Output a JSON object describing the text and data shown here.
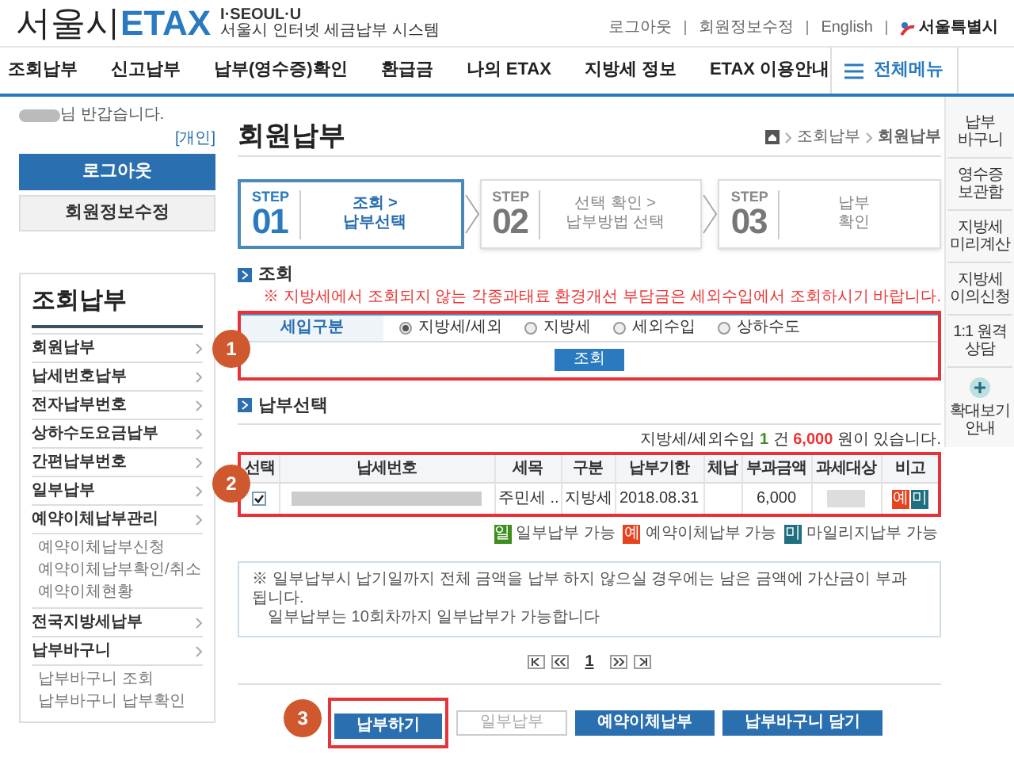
{
  "header": {
    "logo_main": "서울시",
    "logo_accent": "ETAX",
    "brand": "I·SEOUL·U",
    "subtitle": "서울시 인터넷 세금납부 시스템",
    "top_links": [
      "로그아웃",
      "회원정보수정",
      "English"
    ],
    "city": "서울특별시"
  },
  "nav": {
    "items": [
      "조회납부",
      "신고납부",
      "납부(영수증)확인",
      "환급금",
      "나의 ETAX",
      "지방세 정보",
      "ETAX 이용안내"
    ],
    "all_menu": "전체메뉴"
  },
  "member": {
    "greeting": "님 반갑습니다.",
    "type": "[개인]",
    "logout": "로그아웃",
    "edit": "회원정보수정"
  },
  "sidebar": {
    "title": "조회납부",
    "items": [
      {
        "label": "회원납부"
      },
      {
        "label": "납세번호납부"
      },
      {
        "label": "전자납부번호"
      },
      {
        "label": "상하수도요금납부"
      },
      {
        "label": "간편납부번호"
      },
      {
        "label": "일부납부"
      },
      {
        "label": "예약이체납부관리",
        "children": [
          {
            "label": "예약이체납부신청"
          },
          {
            "label": "예약이체납부확인/취소"
          },
          {
            "label": "예약이체현황"
          }
        ]
      },
      {
        "label": "전국지방세납부"
      },
      {
        "label": "납부바구니",
        "children": [
          {
            "label": "납부바구니 조회"
          },
          {
            "label": "납부바구니 납부확인"
          }
        ]
      }
    ]
  },
  "page": {
    "title": "회원납부",
    "breadcrumb": [
      "조회납부",
      "회원납부"
    ]
  },
  "steps": [
    {
      "tag": "STEP",
      "number": "01",
      "lines": [
        "조회 >",
        "납부선택"
      ],
      "selected": true
    },
    {
      "tag": "STEP",
      "number": "02",
      "lines": [
        "선택 확인 >",
        "납부방법 선택"
      ],
      "selected": false
    },
    {
      "tag": "STEP",
      "number": "03",
      "lines": [
        "납부",
        "확인"
      ],
      "selected": false
    }
  ],
  "query": {
    "heading": "조회",
    "notice": "※ 지방세에서 조회되지 않는 각종과태료 환경개선 부담금은 세외수입에서 조회하시기 바랍니다.",
    "field_label": "세입구분",
    "options": [
      {
        "label": "지방세/세외",
        "selected": true
      },
      {
        "label": "지방세",
        "selected": false
      },
      {
        "label": "세외수입",
        "selected": false
      },
      {
        "label": "상하수도",
        "selected": false
      }
    ],
    "button": "조회",
    "annotation": "1"
  },
  "selection": {
    "heading": "납부선택",
    "summary": [
      {
        "kind": "plain",
        "text": "지방세/세외수입"
      },
      {
        "kind": "count",
        "text": "1"
      },
      {
        "kind": "plain",
        "text": "건"
      },
      {
        "kind": "amount",
        "text": "6,000"
      },
      {
        "kind": "plain",
        "text": "원이 있습니다."
      }
    ],
    "annotation": "2",
    "table": {
      "columns": [
        "선택",
        "납세번호",
        "세목",
        "구분",
        "납부기한",
        "체납",
        "부과금액",
        "과세대상",
        "비고"
      ],
      "rows": [
        {
          "checked": true,
          "item": "주민세 ..",
          "type": "지방세",
          "due": "2018.08.31",
          "amount": "6,000",
          "badges": [
            {
              "text": "예",
              "color": "#e8431f"
            },
            {
              "text": "미",
              "color": "#1f6f80"
            }
          ]
        }
      ]
    },
    "legend": [
      {
        "badge": "일",
        "color": "#3c8f1c",
        "label": "일부납부 가능"
      },
      {
        "badge": "예",
        "color": "#e8431f",
        "label": "예약이체납부 가능"
      },
      {
        "badge": "미",
        "color": "#1f6f80",
        "label": "마일리지납부 가능"
      }
    ],
    "notice": [
      "※ 일부납부시 납기일까지 전체 금액을 납부 하지 않으실 경우에는 남은 금액에 가산금이 부과 됩니다.",
      "일부납부는 10회차까지 일부납부가 가능합니다"
    ],
    "pagination": {
      "current": "1"
    }
  },
  "actions": {
    "buttons": [
      {
        "label": "납부하기",
        "disabled": false,
        "annotation": "3"
      },
      {
        "label": "일부납부",
        "disabled": true
      },
      {
        "label": "예약이체납부",
        "disabled": false
      },
      {
        "label": "납부바구니 담기",
        "disabled": false
      }
    ]
  },
  "rail": {
    "items": [
      [
        "납부",
        "바구니"
      ],
      [
        "영수증",
        "보관함"
      ],
      [
        "지방세",
        "미리계산"
      ],
      [
        "지방세",
        "이의신청"
      ],
      [
        "1:1 원격",
        "상담"
      ]
    ],
    "zoom_guide": [
      "확대보기",
      "안내"
    ]
  }
}
